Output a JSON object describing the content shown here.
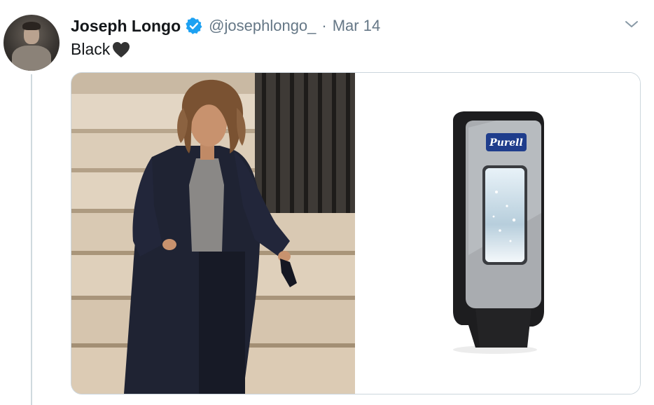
{
  "tweet": {
    "display_name": "Joseph Longo",
    "handle": "@josephlongo_",
    "separator": "·",
    "date": "Mar 14",
    "text": "Black",
    "emoji": "black-heart"
  },
  "media": {
    "left_image": "woman-in-black-coat-on-stairs-photo",
    "right_image": "purell-dispenser-photo",
    "dispenser_logo_text": "Purell"
  },
  "colors": {
    "text": "#14171a",
    "secondary": "#657786",
    "verified": "#1da1f2",
    "border": "#ccd6dd"
  },
  "icons": {
    "verified": "verified-badge-icon",
    "menu": "chevron-down-icon",
    "emoji": "black-heart-icon"
  }
}
